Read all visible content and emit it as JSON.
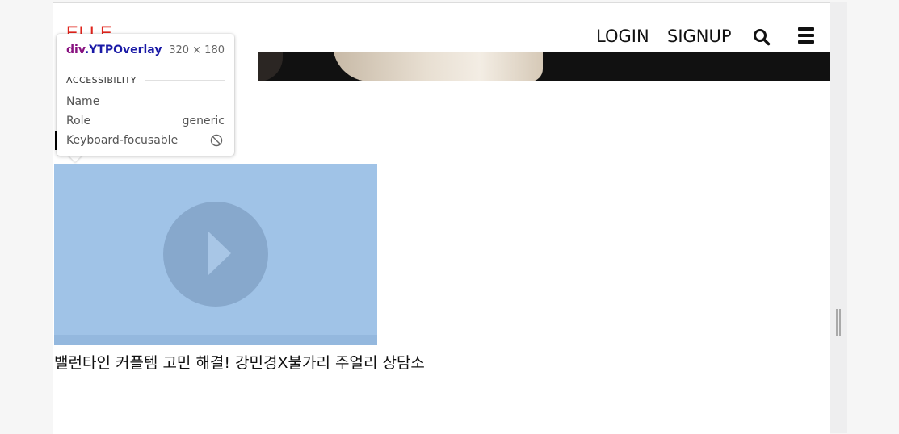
{
  "header": {
    "logo": "ELLE",
    "login": "LOGIN",
    "signup": "SIGNUP",
    "search_icon": "search-icon",
    "menu_icon": "hamburger-menu-icon"
  },
  "video": {
    "title": "밸런타인 커플템 고민 해결! 강민경X불가리 주얼리 상담소",
    "play_icon": "play-icon",
    "overlay_color": "#a0c3e7"
  },
  "devtools_tooltip": {
    "selector_tag": "div",
    "selector_class": ".YTPOverlay",
    "dimensions": "320 × 180",
    "section": "ACCESSIBILITY",
    "rows": [
      {
        "label": "Name",
        "value": ""
      },
      {
        "label": "Role",
        "value": "generic"
      },
      {
        "label": "Keyboard-focusable",
        "value": ""
      }
    ],
    "not_focusable_icon": "ban-icon"
  },
  "colors": {
    "logo": "#e0241b",
    "highlight": "#a0c3e7",
    "selector_tag": "#881280",
    "selector_class": "#1a1aa6"
  }
}
